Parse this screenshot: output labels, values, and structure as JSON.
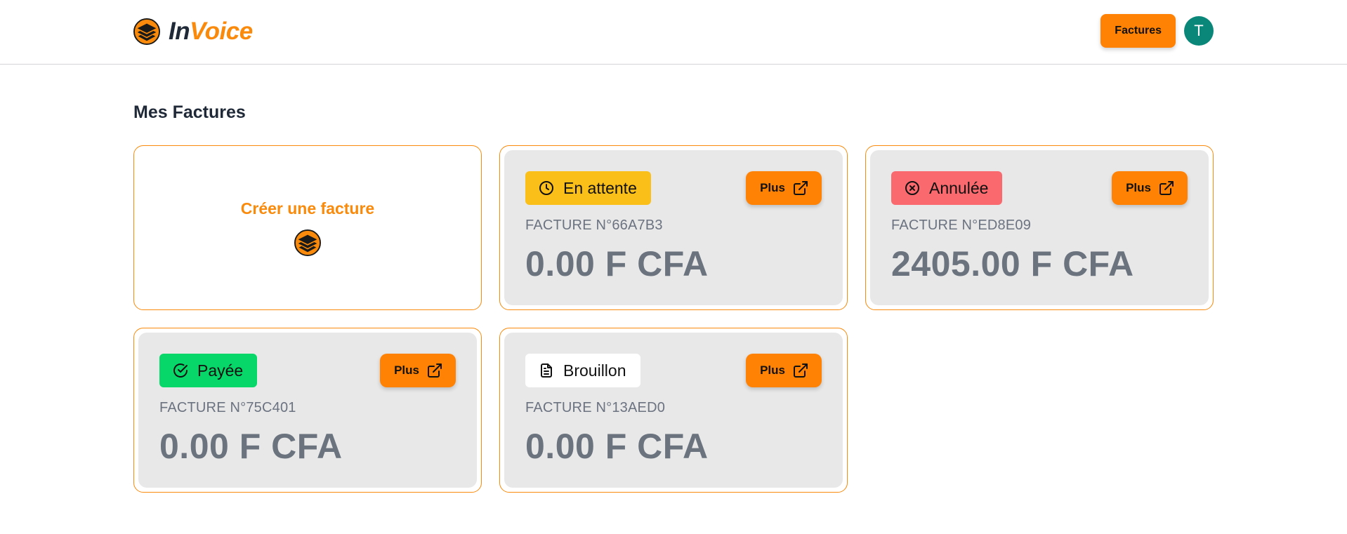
{
  "app": {
    "brand_part1": "In",
    "brand_part2": "Voice",
    "accent_color": "#f98a0b"
  },
  "nav": {
    "factures_label": "Factures",
    "avatar_initial": "T"
  },
  "page": {
    "title": "Mes Factures"
  },
  "create_card": {
    "label": "Créer une facture",
    "icon": "layers-icon"
  },
  "invoices": [
    {
      "status": "En attente",
      "status_icon": "clock-icon",
      "status_color": "#fbbf1a",
      "button_label": "Plus",
      "number": "FACTURE N°66A7B3",
      "amount": "0.00 F CFA"
    },
    {
      "status": "Annulée",
      "status_icon": "x-circle-icon",
      "status_color": "#f9696e",
      "button_label": "Plus",
      "number": "FACTURE N°ED8E09",
      "amount": "2405.00 F CFA"
    },
    {
      "status": "Payée",
      "status_icon": "check-circle-icon",
      "status_color": "#07d768",
      "button_label": "Plus",
      "number": "FACTURE N°75C401",
      "amount": "0.00 F CFA"
    },
    {
      "status": "Brouillon",
      "status_icon": "document-icon",
      "status_color": "#ffffff",
      "button_label": "Plus",
      "number": "FACTURE N°13AED0",
      "amount": "0.00 F CFA"
    }
  ]
}
